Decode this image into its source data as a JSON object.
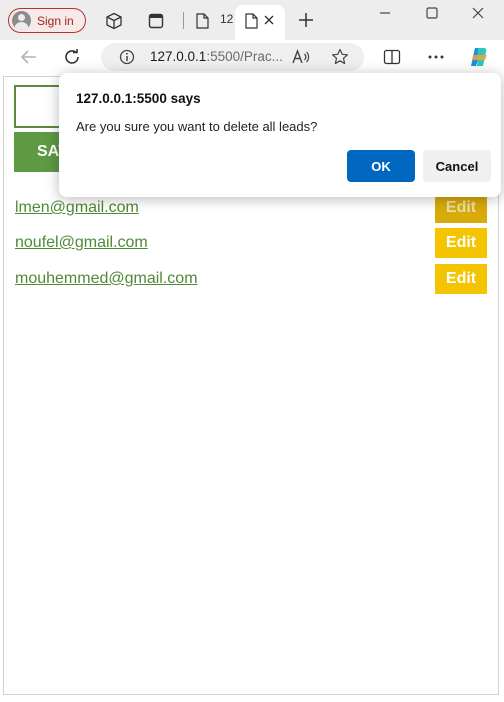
{
  "browser": {
    "sign_in_label": "Sign in",
    "tab_title_truncated": "12",
    "address": {
      "host": "127.0.0.1",
      "rest": ":5500/Prac..."
    },
    "icons": [
      "workspaces-icon",
      "tab-actions-icon",
      "page-icon",
      "new-tab-plus-icon",
      "minimize-icon",
      "maximize-icon",
      "close-window-icon",
      "back-icon",
      "refresh-icon",
      "site-info-icon",
      "read-aloud-icon",
      "favorite-star-icon",
      "split-screen-icon",
      "more-menu-icon",
      "copilot-icon"
    ]
  },
  "page": {
    "save_label": "SAVE",
    "leads": [
      {
        "email": "lmen@gmail.com",
        "edit_label": "Edit"
      },
      {
        "email": "noufel@gmail.com",
        "edit_label": "Edit"
      },
      {
        "email": "mouhemmed@gmail.com",
        "edit_label": "Edit"
      }
    ]
  },
  "dialog": {
    "title": "127.0.0.1:5500 says",
    "message": "Are you sure you want to delete all leads?",
    "ok_label": "OK",
    "cancel_label": "Cancel"
  },
  "colors": {
    "accent_blue": "#0067c0",
    "save_green": "#5e9a44",
    "link_green": "#4f8a36",
    "edit_yellow": "#f5c400",
    "edit_yellow_dim": "#d9ab0a"
  }
}
